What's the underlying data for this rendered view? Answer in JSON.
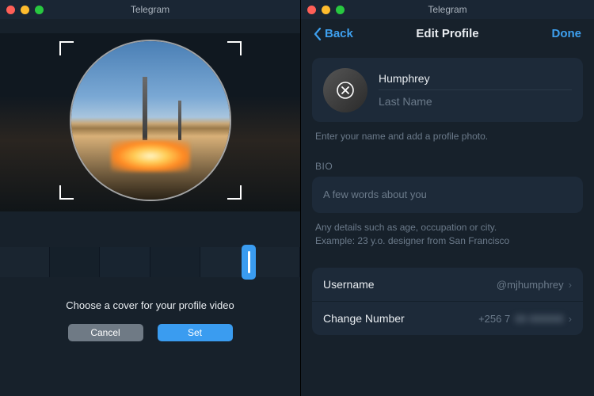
{
  "left": {
    "title": "Telegram",
    "caption": "Choose a cover for your profile video",
    "cancel": "Cancel",
    "set": "Set"
  },
  "right": {
    "title": "Telegram",
    "back": "Back",
    "page_title": "Edit Profile",
    "done": "Done",
    "first_name": "Humphrey",
    "last_name_placeholder": "Last Name",
    "name_hint": "Enter your name and add a profile photo.",
    "bio_label": "BIO",
    "bio_placeholder": "A few words about you",
    "bio_hint": "Any details such as age, occupation or city.\nExample: 23 y.o. designer from San Francisco",
    "rows": {
      "username_label": "Username",
      "username_value": "@mjhumphrey",
      "number_label": "Change Number",
      "number_value": "+256 7"
    }
  }
}
